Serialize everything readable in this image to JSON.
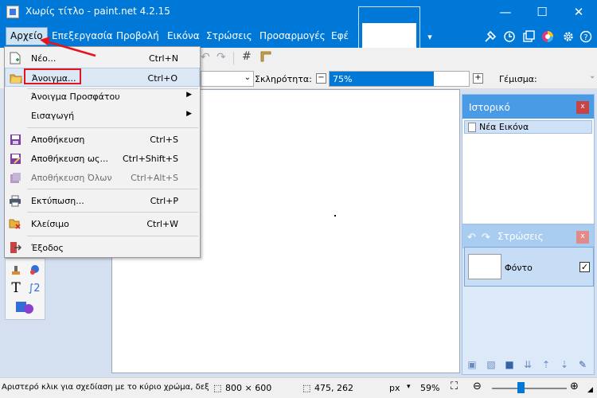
{
  "window": {
    "title": "Χωρίς τίτλο - paint.net 4.2.15",
    "minimize_glyph": "—",
    "maximize_glyph": "☐",
    "close_glyph": "✕"
  },
  "menubar": {
    "items": [
      "Αρχείο",
      "Επεξεργασία",
      "Προβολή",
      "Εικόνα",
      "Στρώσεις",
      "Προσαρμογές",
      "Εφέ"
    ]
  },
  "toolbar": {
    "hardness_label": "Σκληρότητα:",
    "hardness_value": "75%",
    "hardness_percent": 75,
    "fill_label": "Γέμισμα:",
    "minus_glyph": "−",
    "plus_glyph": "+",
    "dropdown_glyph": "⌄"
  },
  "file_menu": {
    "items": [
      {
        "label": "Νέο...",
        "shortcut": "Ctrl+N",
        "icon": "new-document-icon"
      },
      {
        "label": "Άνοιγμα...",
        "shortcut": "Ctrl+O",
        "icon": "open-folder-icon"
      },
      {
        "label": "Άνοιγμα Προσφάτου",
        "shortcut": "",
        "icon": ""
      },
      {
        "label": "Εισαγωγή",
        "shortcut": "",
        "icon": ""
      },
      {
        "label": "Αποθήκευση",
        "shortcut": "Ctrl+S",
        "icon": "save-icon"
      },
      {
        "label": "Αποθήκευση ως...",
        "shortcut": "Ctrl+Shift+S",
        "icon": "save-as-icon"
      },
      {
        "label": "Αποθήκευση Όλων",
        "shortcut": "Ctrl+Alt+S",
        "icon": "save-all-icon"
      },
      {
        "label": "Εκτύπωση...",
        "shortcut": "Ctrl+P",
        "icon": "print-icon"
      },
      {
        "label": "Κλείσιμο",
        "shortcut": "Ctrl+W",
        "icon": "close-document-icon"
      },
      {
        "label": "Έξοδος",
        "shortcut": "",
        "icon": "exit-icon"
      }
    ],
    "submenu_glyph": "▶"
  },
  "history_panel": {
    "title": "Ιστορικό",
    "items": [
      "Νέα Εικόνα"
    ],
    "close_glyph": "x"
  },
  "layers_panel": {
    "title": "Στρώσεις",
    "layer_name": "Φόντο",
    "checked_glyph": "✓",
    "close_glyph": "x"
  },
  "statusbar": {
    "hint": "Αριστερό κλικ για σχεδίαση με το κύριο χρώμα, δεξί κλικ για χρήση του δε...",
    "image_size": "800 × 600",
    "cursor_position": "475, 262",
    "units": "px",
    "zoom": "59%"
  },
  "colors": {
    "accent": "#0078d7",
    "highlight_red": "#e3141c",
    "panel_header": "#4a9be6"
  }
}
